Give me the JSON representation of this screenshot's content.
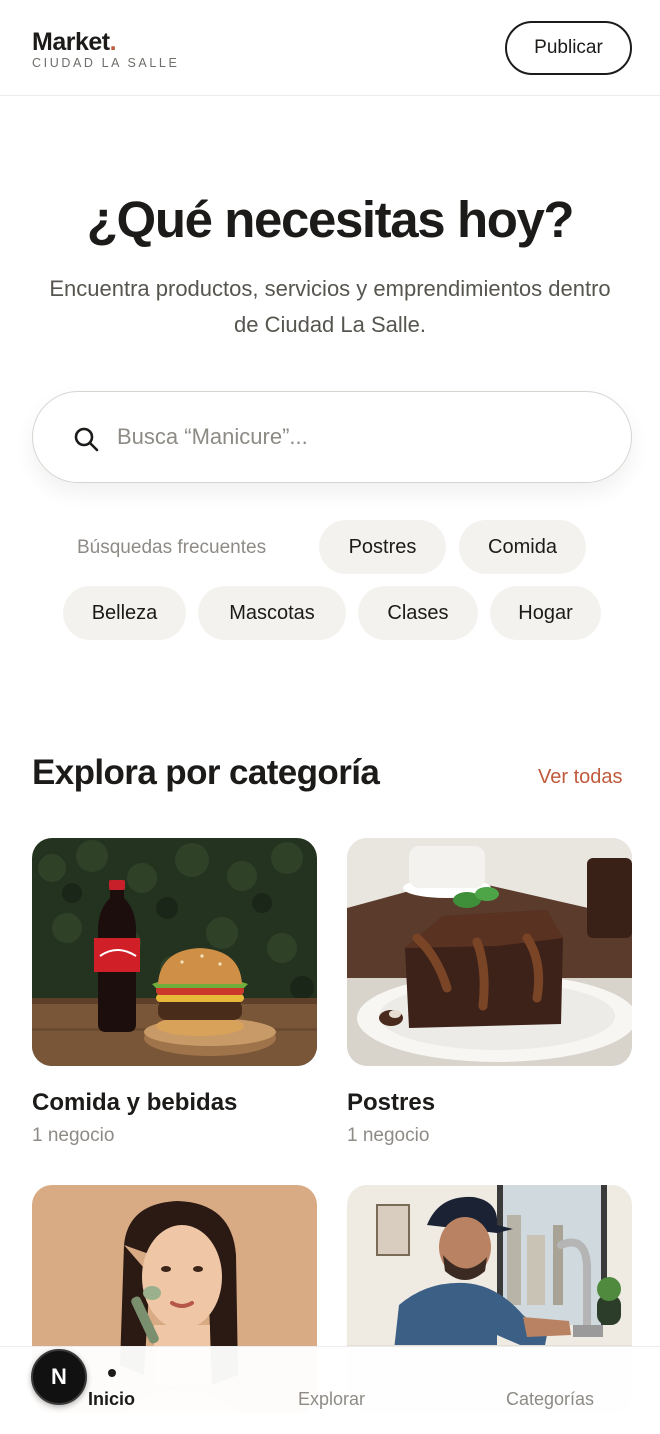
{
  "header": {
    "brand_name": "Market",
    "brand_dot": ".",
    "brand_sub": "CIUDAD LA SALLE",
    "publish_label": "Publicar"
  },
  "hero": {
    "title": "¿Qué necesitas hoy?",
    "subtitle": "Encuentra productos, servicios y emprendimientos dentro de Ciudad La Salle."
  },
  "search": {
    "placeholder": "Busca “Manicure”...",
    "value": ""
  },
  "frequent": {
    "label": "Búsquedas frecuentes",
    "chips": [
      "Postres",
      "Comida",
      "Belleza",
      "Mascotas",
      "Clases",
      "Hogar"
    ]
  },
  "categories": {
    "title": "Explora por categoría",
    "see_all": "Ver todas",
    "items": [
      {
        "name": "Comida y bebidas",
        "count": "1 negocio",
        "image": "burger-and-cola"
      },
      {
        "name": "Postres",
        "count": "1 negocio",
        "image": "chocolate-brownie"
      },
      {
        "name": "",
        "count": "",
        "image": "woman-with-face-roller"
      },
      {
        "name": "",
        "count": "",
        "image": "plumber-fixing-faucet"
      }
    ]
  },
  "bottom_nav": {
    "items": [
      "Inicio",
      "Explorar",
      "Categorías"
    ],
    "active": "Inicio",
    "badge": "N"
  },
  "colors": {
    "accent": "#c05a3c",
    "text": "#1c1b19",
    "muted": "#8e8b86",
    "chip_bg": "#f3f2ef"
  }
}
